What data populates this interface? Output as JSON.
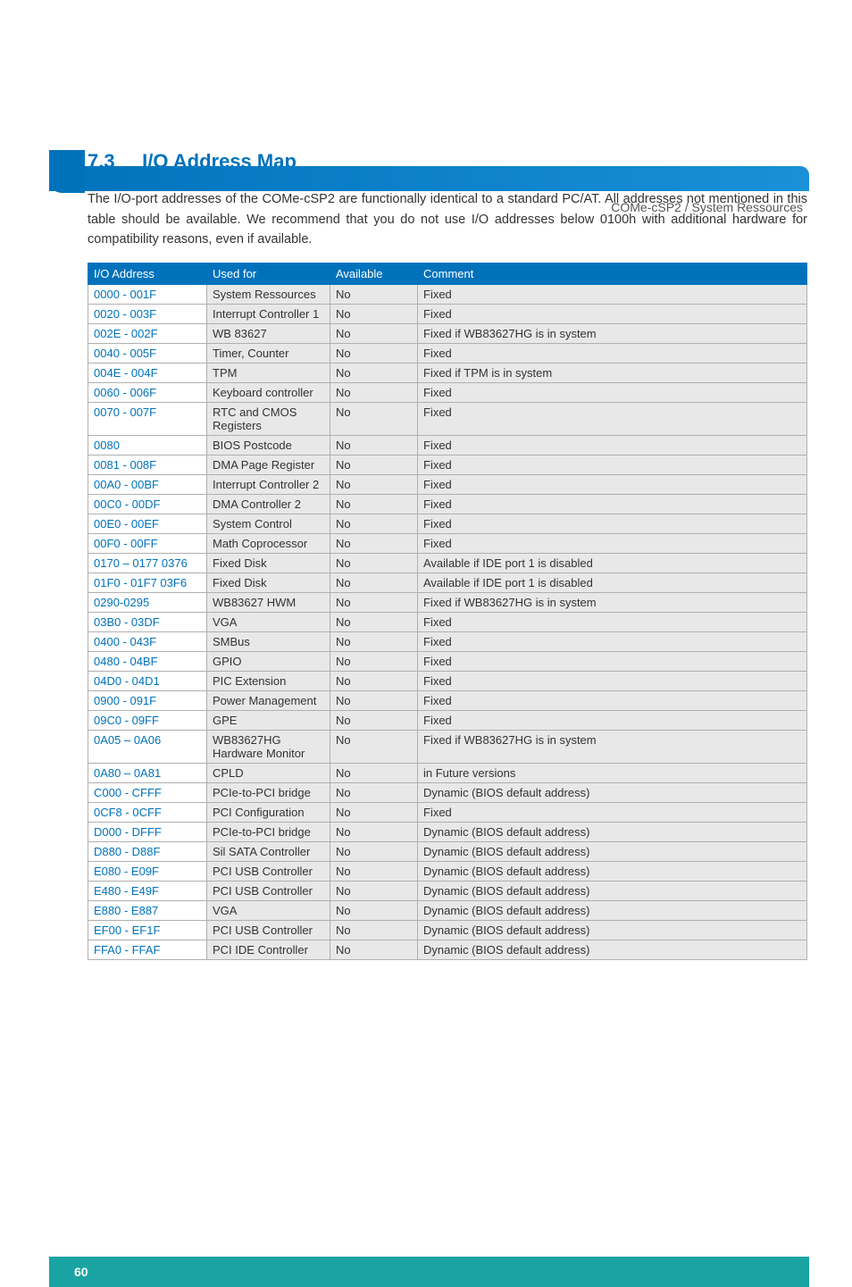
{
  "header": {
    "breadcrumb": "COMe-cSP2 / System Ressources"
  },
  "section": {
    "number": "7.3",
    "title": "I/O Address Map",
    "intro": "The I/O-port addresses of the COMe-cSP2 are functionally identical to a standard PC/AT. All addresses not mentioned in this table should be available. We recommend that you do not use I/O addresses below 0100h with additional hardware for compatibility reasons, even if available."
  },
  "table": {
    "headers": [
      "I/O Address",
      "Used for",
      "Available",
      "Comment"
    ],
    "rows": [
      [
        "0000 - 001F",
        "System Ressources",
        "No",
        "Fixed"
      ],
      [
        "0020 - 003F",
        "Interrupt Controller 1",
        "No",
        "Fixed"
      ],
      [
        "002E - 002F",
        "WB 83627",
        "No",
        "Fixed if WB83627HG is in system"
      ],
      [
        "0040 - 005F",
        "Timer, Counter",
        "No",
        "Fixed"
      ],
      [
        "004E - 004F",
        "TPM",
        "No",
        "Fixed if TPM is in system"
      ],
      [
        "0060 - 006F",
        "Keyboard controller",
        "No",
        "Fixed"
      ],
      [
        "0070 - 007F",
        "RTC and CMOS Registers",
        "No",
        "Fixed"
      ],
      [
        "0080",
        "BIOS Postcode",
        "No",
        "Fixed"
      ],
      [
        "0081 - 008F",
        "DMA Page Register",
        "No",
        "Fixed"
      ],
      [
        "00A0 - 00BF",
        "Interrupt Controller 2",
        "No",
        "Fixed"
      ],
      [
        "00C0 - 00DF",
        "DMA Controller 2",
        "No",
        "Fixed"
      ],
      [
        "00E0 - 00EF",
        "System Control",
        "No",
        "Fixed"
      ],
      [
        "00F0 - 00FF",
        "Math Coprocessor",
        "No",
        "Fixed"
      ],
      [
        "0170 – 0177 0376",
        "Fixed Disk",
        "No",
        "Available if IDE port 1 is disabled"
      ],
      [
        "01F0 - 01F7 03F6",
        "Fixed Disk",
        "No",
        "Available if IDE port 1 is disabled"
      ],
      [
        "0290-0295",
        "WB83627 HWM",
        "No",
        "Fixed if WB83627HG is in system"
      ],
      [
        "03B0 - 03DF",
        "VGA",
        "No",
        "Fixed"
      ],
      [
        "0400 - 043F",
        "SMBus",
        "No",
        "Fixed"
      ],
      [
        "0480 - 04BF",
        "GPIO",
        "No",
        "Fixed"
      ],
      [
        "04D0 - 04D1",
        "PIC Extension",
        "No",
        "Fixed"
      ],
      [
        "0900 - 091F",
        "Power Management",
        "No",
        "Fixed"
      ],
      [
        "09C0 - 09FF",
        "GPE",
        "No",
        "Fixed"
      ],
      [
        "0A05 – 0A06",
        "WB83627HG Hardware Monitor",
        "No",
        "Fixed if WB83627HG is in system"
      ],
      [
        "0A80 – 0A81",
        "CPLD",
        "No",
        "in Future versions"
      ],
      [
        "C000 - CFFF",
        "PCIe-to-PCI bridge",
        "No",
        "Dynamic (BIOS default address)"
      ],
      [
        "0CF8 - 0CFF",
        "PCI Configuration",
        "No",
        "Fixed"
      ],
      [
        "D000 - DFFF",
        "PCIe-to-PCI bridge",
        "No",
        "Dynamic (BIOS default address)"
      ],
      [
        "D880 - D88F",
        "Sil SATA Controller",
        "No",
        "Dynamic (BIOS default address)"
      ],
      [
        "E080 - E09F",
        "PCI USB Controller",
        "No",
        "Dynamic (BIOS default address)"
      ],
      [
        "E480 - E49F",
        "PCI USB Controller",
        "No",
        "Dynamic (BIOS default address)"
      ],
      [
        "E880 - E887",
        "VGA",
        "No",
        "Dynamic (BIOS default address)"
      ],
      [
        "EF00 - EF1F",
        "PCI USB Controller",
        "No",
        "Dynamic (BIOS default address)"
      ],
      [
        "FFA0 - FFAF",
        "PCI IDE Controller",
        "No",
        "Dynamic (BIOS default address)"
      ]
    ]
  },
  "footer": {
    "page": "60"
  }
}
